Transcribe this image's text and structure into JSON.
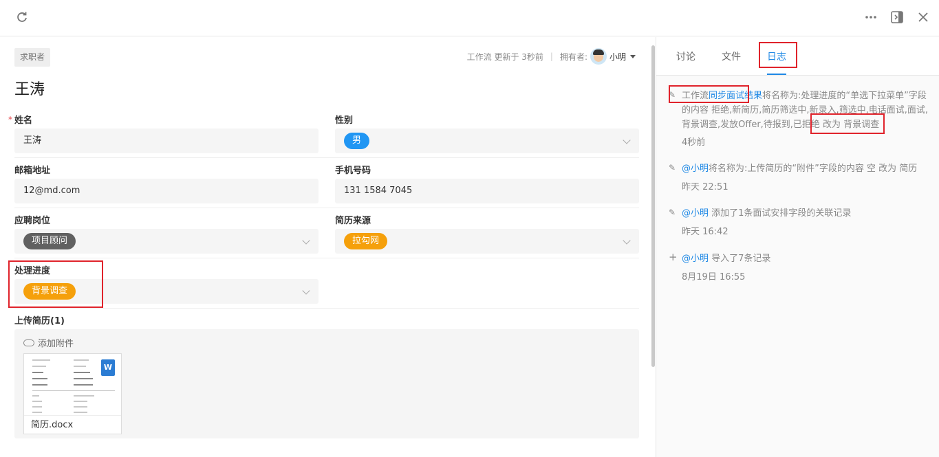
{
  "topbar": {
    "refresh_icon": "refresh-icon",
    "more_icon": "more-icon",
    "sidebar_icon": "sidebar-collapse-icon",
    "close_icon": "close-icon"
  },
  "record": {
    "category": "求职者",
    "title": "王涛",
    "workflow_status": "工作流 更新于 3秒前",
    "owner_label": "拥有者:",
    "owner_name": "小明"
  },
  "fields": {
    "name": {
      "label": "姓名",
      "value": "王涛",
      "required": "*"
    },
    "gender": {
      "label": "性别",
      "value": "男",
      "color": "#2196f3"
    },
    "email": {
      "label": "邮箱地址",
      "value": "12@md.com"
    },
    "phone": {
      "label": "手机号码",
      "value": "131 1584 7045"
    },
    "position": {
      "label": "应聘岗位",
      "value": "项目顾问",
      "color": "#616161"
    },
    "source": {
      "label": "简历来源",
      "value": "拉勾网",
      "color": "#f5a00b"
    },
    "progress": {
      "label": "处理进度",
      "value": "背景调查",
      "color": "#f5a00b"
    },
    "resume": {
      "label": "上传简历(1)",
      "add_label": "添加附件",
      "file_name": "简历.docx",
      "file_badge": "W"
    }
  },
  "panel": {
    "tabs": [
      "讨论",
      "文件",
      "日志"
    ],
    "active_tab": 2,
    "logs": [
      {
        "icon": "pencil-icon",
        "prefix": "工作流",
        "link": "同步面试结果",
        "text": "将名称为:处理进度的“单选下拉菜单”字段的内容 拒绝,新简历,简历筛选中,新录入,筛选中,电话面试,面试,背景调查,发放Offer,待报到,已拒绝 改为 背景调查",
        "time": "4秒前"
      },
      {
        "icon": "pencil-icon",
        "prefix": "",
        "link": "@小明",
        "text": "将名称为:上传简历的“附件”字段的内容 空 改为 简历",
        "time": "昨天 22:51"
      },
      {
        "icon": "pencil-icon",
        "prefix": "",
        "link": "@小明",
        "text": " 添加了1条面试安排字段的关联记录",
        "time": "昨天 16:42"
      },
      {
        "icon": "plus-icon",
        "prefix": "",
        "link": "@小明",
        "text": " 导入了7条记录",
        "time": "8月19日 16:55"
      }
    ]
  }
}
